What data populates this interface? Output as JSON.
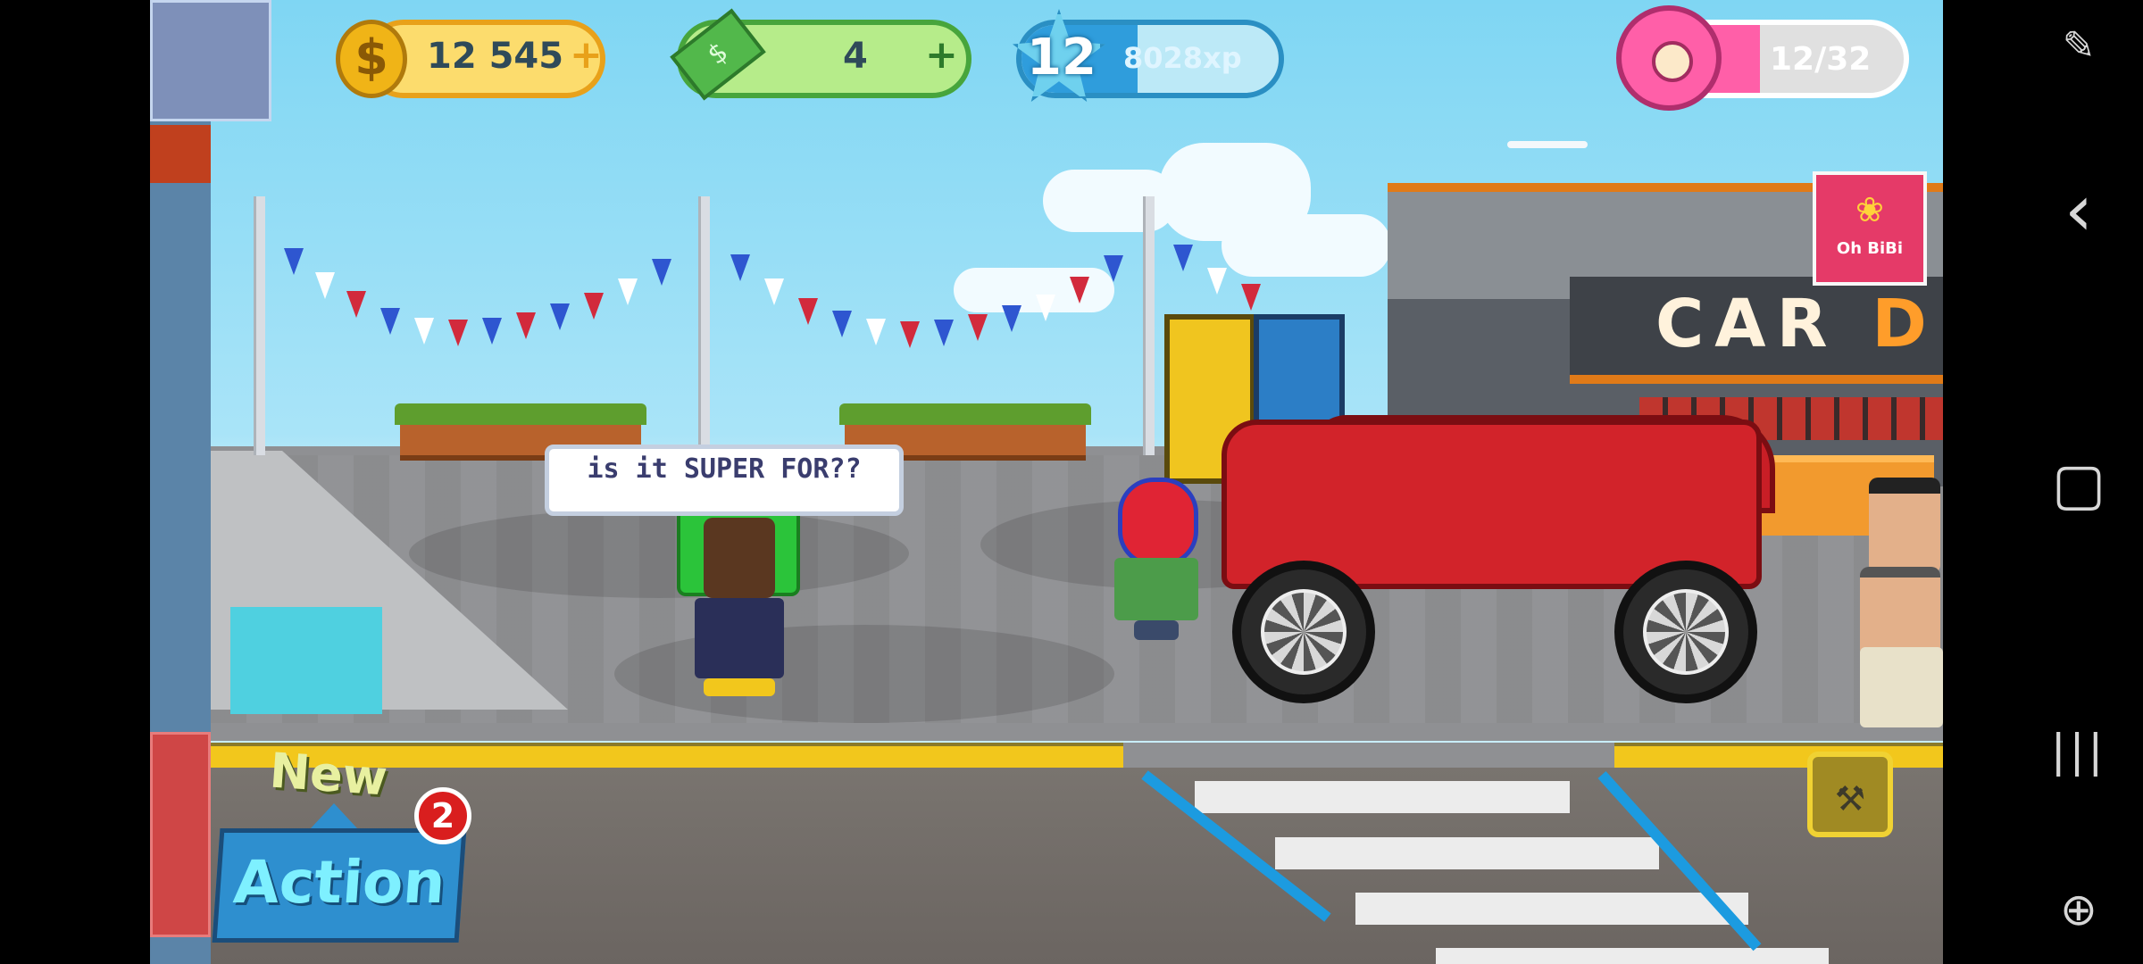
{
  "hud": {
    "coins": "12 545",
    "coin_plus": "+",
    "cash": "4",
    "cash_plus": "+",
    "level": "12",
    "xp": "8028xp",
    "xp_progress": 0.45,
    "donuts": "12/32",
    "donut_progress": 0.375
  },
  "speech_bubble": {
    "text": "is it SUPER FOR??"
  },
  "building": {
    "sign_main": "CAR",
    "sign_accent": "DE",
    "logo_text": "Oh BiBi"
  },
  "actions": {
    "new_label": "New",
    "badge_count": "2",
    "action_label": "Action"
  },
  "icons": {
    "coin": "$",
    "cash": "cash-icon",
    "wrench": "wrench-icon"
  },
  "system_nav": {
    "back": "‹",
    "home": "▢",
    "recents": "|||"
  },
  "colors": {
    "sky": "#7fd6f3",
    "curb": "#f2c71c",
    "car": "#d2232a",
    "action_button": "#2e8fcf",
    "donut": "#ff5fa8"
  }
}
